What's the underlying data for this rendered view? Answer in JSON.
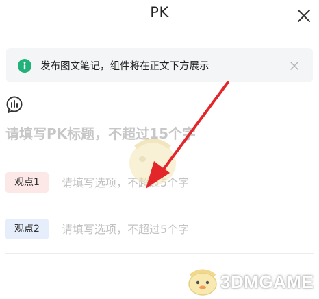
{
  "header": {
    "title": "PK",
    "close_icon": "close-icon"
  },
  "notice": {
    "icon": "info-icon",
    "text": "发布图文笔记，组件将在正文下方展示",
    "close_icon": "close-icon",
    "accent_color": "#21b27a"
  },
  "poll": {
    "icon": "poll-chart-icon",
    "title_placeholder": "请填写PK标题，不超过15个字"
  },
  "options": [
    {
      "tag": "观点1",
      "placeholder": "请填写选项，不超过5个字",
      "tag_color": "#fde8e8"
    },
    {
      "tag": "观点2",
      "placeholder": "请填写选项，不超过5个字",
      "tag_color": "#e6eefb"
    }
  ],
  "annotation": {
    "arrow_color": "#e3262a"
  },
  "watermark": {
    "text": "3DMGAME"
  }
}
